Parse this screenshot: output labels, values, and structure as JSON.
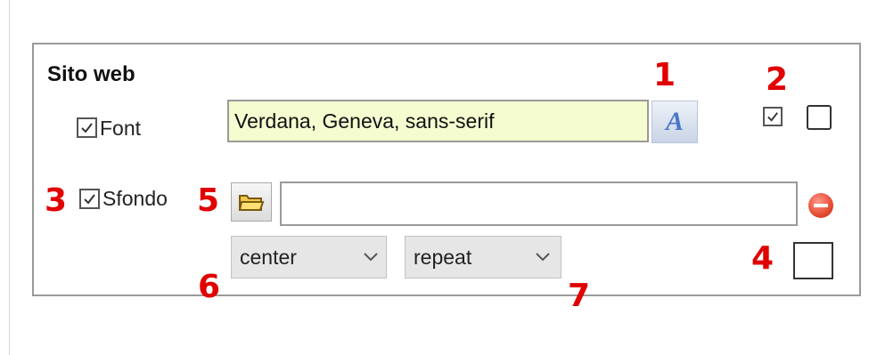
{
  "group": {
    "title": "Sito web"
  },
  "font": {
    "label": "Font",
    "checked": true,
    "value": "Verdana, Geneva, sans-serif",
    "button_glyph": "A",
    "button_icon": "font-icon"
  },
  "style_checks": {
    "checkbox_a_checked": true,
    "checkbox_b_checked": false
  },
  "background": {
    "label": "Sfondo",
    "checked": true,
    "path": "",
    "browse_icon": "folder-icon",
    "remove_icon": "remove-icon"
  },
  "position_select": {
    "value": "center"
  },
  "repeat_select": {
    "value": "repeat"
  },
  "color_swatch": {
    "checked": false
  },
  "callouts": [
    "1",
    "2",
    "3",
    "4",
    "5",
    "6",
    "7"
  ],
  "colors": {
    "callout": "#e00000",
    "font_field_bg": "#f4fcd0",
    "remove": "#e64a32"
  }
}
